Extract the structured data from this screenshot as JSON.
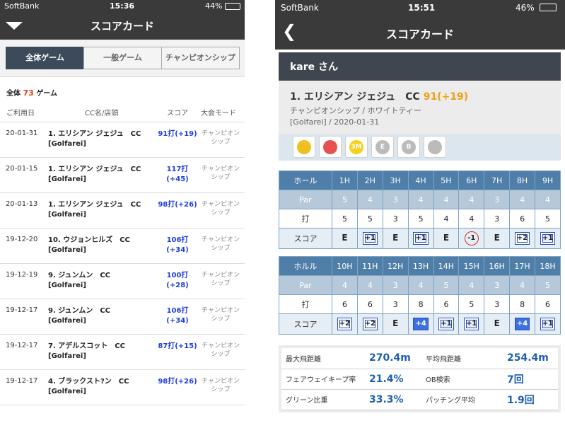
{
  "left": {
    "status": {
      "carrier": "SoftBank",
      "time": "15:36",
      "battery": "44%"
    },
    "nav_title": "スコアカード",
    "tabs": [
      "全体ゲーム",
      "一般ゲーム",
      "チャンピオンシップ"
    ],
    "count": {
      "prefix": "全体",
      "value": "73",
      "suffix": "ゲーム"
    },
    "columns": {
      "date": "ご利用日",
      "course": "CC名/店頭",
      "score": "スコア",
      "mode": "大会モード"
    },
    "rows": [
      {
        "date": "20-01-31",
        "course1": "1. エリシアン ジェジュ　CC",
        "course2": "[Golfarei]",
        "score1": "91打(+19)",
        "score2": "",
        "mode1": "チャンピオン",
        "mode2": "シップ"
      },
      {
        "date": "20-01-15",
        "course1": "1. エリシアン ジェジュ　CC",
        "course2": "[Golfarei]",
        "score1": "117打(+45)",
        "score2": "",
        "mode1": "チャンピオン",
        "mode2": "シップ"
      },
      {
        "date": "20-01-13",
        "course1": "1. エリシアン ジェジュ　CC",
        "course2": "[Golfarei]",
        "score1": "98打(+26)",
        "score2": "",
        "mode1": "チャンピオン",
        "mode2": "シップ"
      },
      {
        "date": "19-12-20",
        "course1": "10. ウジョンヒルズ　CC",
        "course2": "[Golfarei]",
        "score1": "106打",
        "score2": "(+34)",
        "mode1": "チャンピオン",
        "mode2": "シップ"
      },
      {
        "date": "19-12-19",
        "course1": "9. ジュンムン　CC",
        "course2": "[Golfarei]",
        "score1": "100打",
        "score2": "(+28)",
        "mode1": "チャンピオン",
        "mode2": "シップ"
      },
      {
        "date": "19-12-17",
        "course1": "9. ジュンムン　CC",
        "course2": "[Golfarei]",
        "score1": "106打",
        "score2": "(+34)",
        "mode1": "チャンピオン",
        "mode2": "シップ"
      },
      {
        "date": "19-12-17",
        "course1": "7. アデルスコット　CC",
        "course2": "[Golfarei]",
        "score1": "87打(+15)",
        "score2": "",
        "mode1": "チャンピオン",
        "mode2": "シップ"
      },
      {
        "date": "19-12-17",
        "course1": "4. ブラックスト?ン　CC",
        "course2": "[Golfarei]",
        "score1": "98打(+26)",
        "score2": "",
        "mode1": "チャンピオン",
        "mode2": "シップ"
      }
    ]
  },
  "right": {
    "status": {
      "carrier": "SoftBank",
      "time": "15:51",
      "battery": "46%"
    },
    "nav_title": "スコアカード",
    "back_glyph": "❮",
    "user": "kare さん",
    "course": {
      "name": "1. エリシアン ジェジュ　CC",
      "score": "91(+19)",
      "tee": "チャンピオンシップ / ホワイトティー",
      "meta": "[Golfarei] / 2020-01-31"
    },
    "badges": [
      {
        "icon": "bird-icon",
        "text": "",
        "color": "#f0c020"
      },
      {
        "icon": "balls-icon",
        "text": "",
        "color": "#e85050"
      },
      {
        "icon": "3m-icon",
        "text": "3M",
        "color": "#f5d020"
      },
      {
        "icon": "e-icon",
        "text": "E",
        "color": "#bbbbbb"
      },
      {
        "icon": "b-icon",
        "text": "B",
        "color": "#bbbbbb"
      },
      {
        "icon": "gift-icon",
        "text": "",
        "color": "#bbbbbb"
      }
    ],
    "front": {
      "label_hole": "ホール",
      "label_par": "Par",
      "label_strokes": "打",
      "label_score": "スコア",
      "holes": [
        "1H",
        "2H",
        "3H",
        "4H",
        "5H",
        "6H",
        "7H",
        "8H",
        "9H"
      ],
      "par": [
        "5",
        "4",
        "3",
        "4",
        "4",
        "4",
        "3",
        "4",
        "4"
      ],
      "strokes": [
        "5",
        "5",
        "3",
        "5",
        "4",
        "4",
        "3",
        "6",
        "5"
      ],
      "score": [
        {
          "t": "E",
          "k": "even"
        },
        {
          "t": "+1",
          "k": "bogey"
        },
        {
          "t": "E",
          "k": "even"
        },
        {
          "t": "+1",
          "k": "bogey"
        },
        {
          "t": "E",
          "k": "even"
        },
        {
          "t": "-1",
          "k": "birdie"
        },
        {
          "t": "E",
          "k": "even"
        },
        {
          "t": "+2",
          "k": "double"
        },
        {
          "t": "+1",
          "k": "bogey"
        }
      ]
    },
    "back": {
      "label_hole": "ホルル",
      "label_par": "Par",
      "label_strokes": "打",
      "label_score": "スコア",
      "holes": [
        "10H",
        "11H",
        "12H",
        "13H",
        "14H",
        "15H",
        "16H",
        "17H",
        "18H"
      ],
      "par": [
        "4",
        "4",
        "3",
        "4",
        "5",
        "4",
        "3",
        "4",
        "5"
      ],
      "strokes": [
        "6",
        "6",
        "3",
        "8",
        "6",
        "5",
        "3",
        "8",
        "6"
      ],
      "score": [
        {
          "t": "+2",
          "k": "double"
        },
        {
          "t": "+2",
          "k": "double"
        },
        {
          "t": "E",
          "k": "even"
        },
        {
          "t": "+4",
          "k": "triple"
        },
        {
          "t": "+1",
          "k": "bogey"
        },
        {
          "t": "+1",
          "k": "bogey"
        },
        {
          "t": "E",
          "k": "even"
        },
        {
          "t": "+4",
          "k": "triple"
        },
        {
          "t": "+1",
          "k": "bogey"
        }
      ]
    },
    "stats": [
      {
        "l1": "最大飛距離",
        "v1": "270.4m",
        "l2": "平均飛距離",
        "v2": "254.4m"
      },
      {
        "l1": "フェアウェイキープ率",
        "v1": "21.4%",
        "l2": "OB検索",
        "v2": "7回"
      },
      {
        "l1": "グリーン比重",
        "v1": "33.3%",
        "l2": "パッチング平均",
        "v2": "1.9回"
      }
    ]
  }
}
